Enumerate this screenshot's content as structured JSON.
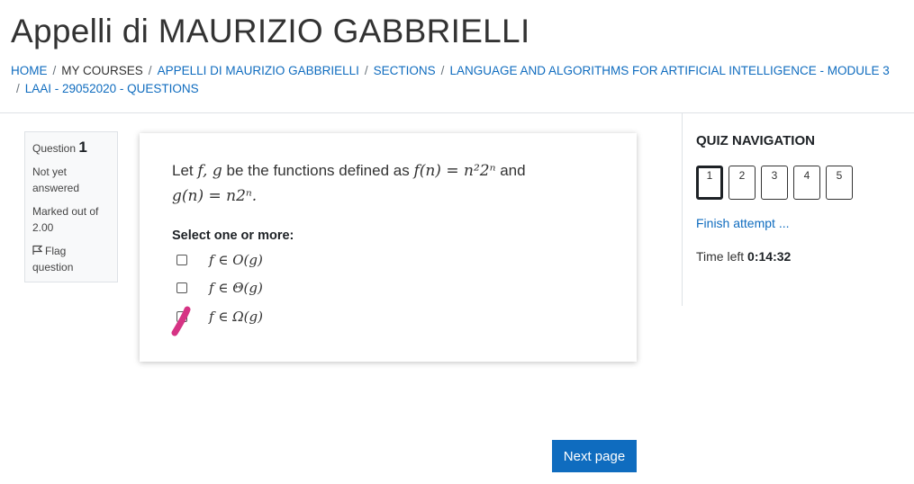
{
  "page_title": "Appelli di MAURIZIO GABBRIELLI",
  "breadcrumb": [
    "HOME",
    "MY COURSES",
    "APPELLI DI MAURIZIO GABBRIELLI",
    "SECTIONS",
    "LANGUAGE AND ALGORITHMS FOR ARTIFICIAL INTELLIGENCE - MODULE 3",
    "LAAI - 29052020 - QUESTIONS"
  ],
  "question_info": {
    "label": "Question",
    "number": "1",
    "status": "Not yet answered",
    "marks": "Marked out of 2.00",
    "flag_label": "Flag question"
  },
  "question": {
    "text_prefix": "Let",
    "f_g": "f, g",
    "text_mid": "be the functions defined as",
    "f_def": "f(n) = n²2ⁿ",
    "and": "and",
    "g_def": "g(n) = n2ⁿ.",
    "prompt": "Select one or more:",
    "options": [
      {
        "label": "f ∈ O(g)",
        "checked": false
      },
      {
        "label": "f ∈ Θ(g)",
        "checked": false
      },
      {
        "label": "f ∈ Ω(g)",
        "checked": false
      }
    ]
  },
  "next_button": "Next page",
  "quiz_nav": {
    "heading": "QUIZ NAVIGATION",
    "buttons": [
      "1",
      "2",
      "3",
      "4",
      "5"
    ],
    "current": "1",
    "finish_link": "Finish attempt ...",
    "time_label": "Time left",
    "time_value": "0:14:32"
  },
  "colors": {
    "link": "#0f6cbf",
    "primary_button": "#0f6cbf",
    "annotation_mark": "#d63384"
  }
}
